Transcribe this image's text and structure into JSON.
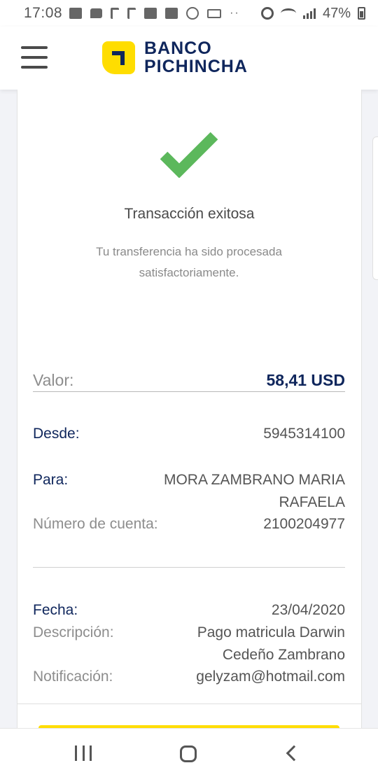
{
  "status_bar": {
    "time": "17:08",
    "battery_percent": "47%"
  },
  "header": {
    "brand_line1": "BANCO",
    "brand_line2": "PICHINCHA",
    "brand_color": "#0f265c",
    "logo_color": "#ffdd00"
  },
  "result": {
    "title": "Transacción exitosa",
    "subtitle": "Tu transferencia ha sido procesada satisfactoriamente.",
    "success_color": "#5cb85c"
  },
  "details": {
    "valor_label": "Valor:",
    "valor_value": "58,41 USD",
    "desde_label": "Desde:",
    "desde_value": "5945314100",
    "para_label": "Para:",
    "para_value_line1": "MORA ZAMBRANO MARIA",
    "para_value_line2": "RAFAELA",
    "cuenta_label": "Número de cuenta:",
    "cuenta_value": "2100204977",
    "fecha_label": "Fecha:",
    "fecha_value": "23/04/2020",
    "descripcion_label": "Descripción:",
    "descripcion_line1": "Pago matricula Darwin",
    "descripcion_line2": "Cedeño Zambrano",
    "notificacion_label": "Notificación:",
    "notificacion_value": "gelyzam@hotmail.com"
  }
}
